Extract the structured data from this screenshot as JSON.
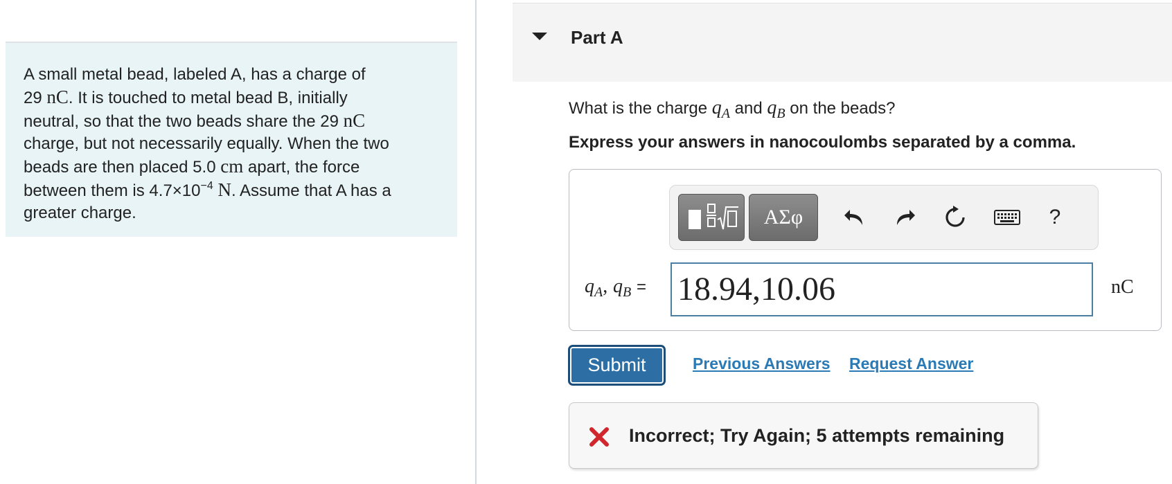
{
  "problem": {
    "line1": "A small metal bead, labeled A, has a charge of",
    "line2_num": "29",
    "unit_nC": "nC",
    "line2_rest": ". It is touched to metal bead B, initially",
    "line3_pre": "neutral, so that the two beads share the 29",
    "line4": "charge, but not necessarily equally. When the two",
    "line5_pre": "beads are then placed 5.0",
    "unit_cm": "cm",
    "line5_post": "apart, the force",
    "line6_pre": "between them is 4.7×10",
    "exponent": "−4",
    "unit_N": "N",
    "line6_post": ". Assume that A has a",
    "line7": "greater charge."
  },
  "part": {
    "title": "Part A"
  },
  "question": {
    "pre": "What is the charge",
    "q": "q",
    "subA": "A",
    "and": "and",
    "subB": "B",
    "post": "on the beads?"
  },
  "instruction": "Express your answers in nanocoulombs separated by a comma.",
  "toolbar": {
    "greek_label": "ΑΣφ",
    "help_label": "?"
  },
  "answer": {
    "label_q": "q",
    "label_subA": "A",
    "label_sep": ",",
    "label_subB": "B",
    "label_eq": "=",
    "value": "18.94,10.06",
    "unit": "nC"
  },
  "actions": {
    "submit": "Submit",
    "previous_answers": "Previous Answers",
    "request_answer": "Request Answer"
  },
  "feedback": {
    "message": "Incorrect; Try Again; 5 attempts remaining",
    "status_color": "#d0262e"
  },
  "colors": {
    "problem_bg": "#e8f4f6",
    "link": "#2a7ab5",
    "submit_bg": "#2d6fa4",
    "input_border": "#4a7ea3"
  }
}
